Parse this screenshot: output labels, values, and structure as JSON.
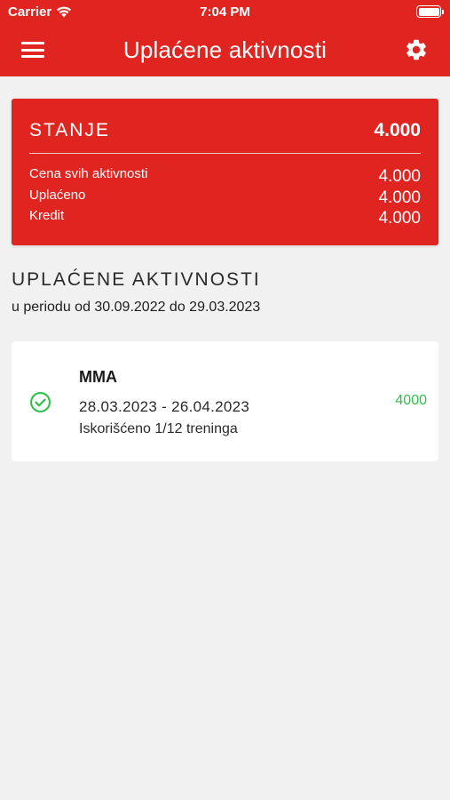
{
  "status_bar": {
    "carrier": "Carrier",
    "time": "7:04 PM",
    "battery_level": 1.0
  },
  "nav": {
    "title": "Uplaćene aktivnosti",
    "menu_icon": "hamburger-menu-icon",
    "settings_icon": "gear-icon"
  },
  "balance": {
    "label": "STANJE",
    "amount": "4.000",
    "rows": [
      {
        "label": "Cena svih aktivnosti",
        "value": "4.000"
      },
      {
        "label": "Uplaćeno",
        "value": "4.000"
      },
      {
        "label": "Kredit",
        "value": "4.000"
      }
    ]
  },
  "section": {
    "title": "UPLAĆENE AKTIVNOSTI",
    "subtitle": "u periodu od 30.09.2022 do 29.03.2023"
  },
  "activities": [
    {
      "name": "MMA",
      "dates": "28.03.2023 - 26.04.2023",
      "usage": "Iskorišćeno 1/12 treninga",
      "price": "4000",
      "status_icon": "check-circle-icon"
    }
  ],
  "colors": {
    "brand_red": "#e02520",
    "background": "#f1f1f1",
    "success_green": "#2fbf4a"
  }
}
